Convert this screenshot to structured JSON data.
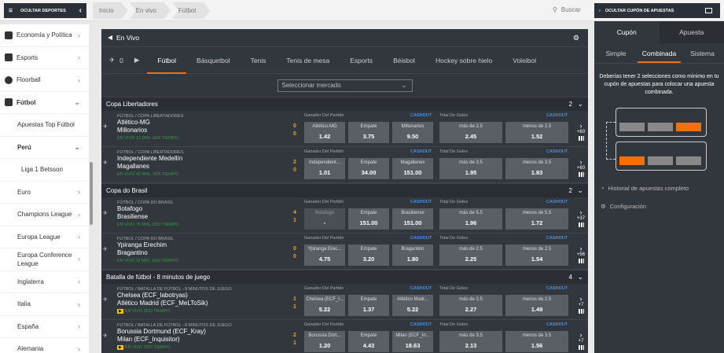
{
  "topbar": {
    "hide_sports": "OCULTAR DEPORTES",
    "breadcrumbs": [
      "Inicio",
      "En vivo",
      "Fútbol"
    ],
    "search_label": "Buscar",
    "hide_coupon": "OCULTAR CUPÓN DE APUESTAS"
  },
  "sidebar": {
    "items": [
      {
        "label": "Economía y Política"
      },
      {
        "label": "Esports"
      },
      {
        "label": "Floorball"
      },
      {
        "label": "Fútbol"
      },
      {
        "label": "Apuestas Top Fútbol"
      },
      {
        "label": "Perú"
      },
      {
        "label": "Liga 1 Betsson"
      },
      {
        "label": "Euro"
      },
      {
        "label": "Champions League"
      },
      {
        "label": "Europa League"
      },
      {
        "label": "Europa Conference League"
      },
      {
        "label": "Inglaterra"
      },
      {
        "label": "Italia"
      },
      {
        "label": "España"
      },
      {
        "label": "Alemania"
      }
    ]
  },
  "main": {
    "title": "En Vivo",
    "fav_count": "0",
    "tabs": [
      "Fútbol",
      "Básquetbol",
      "Tenis",
      "Tenis de mesa",
      "Esports",
      "Béisbol",
      "Hockey sobre hielo",
      "Voleibol"
    ],
    "market_placeholder": "Seleccionar mercado",
    "competitions": [
      {
        "name": "Copa Libertadores",
        "count": "2"
      },
      {
        "name": "Copa do Brasil",
        "count": "2"
      },
      {
        "name": "Batalla de fútbol - 8 minutos de juego",
        "count": "4"
      }
    ],
    "market1": "Ganador Del Partido",
    "market2": "Total De Goles",
    "cashout": "CASHOUT",
    "matches": [
      {
        "league": "FÚTBOL / COPA LIBERTADORES",
        "home": "Atlético-MG",
        "away": "Millonarios",
        "status": "EN VIVO 12 MIN, 1ER TIEMPO",
        "s1": "0",
        "s2": "0",
        "o1l": "Atlético-MG",
        "o1v": "1.42",
        "oxl": "Empate",
        "oxv": "3.75",
        "o2l": "Millonarios",
        "o2v": "9.50",
        "ul": "más de 2.5",
        "uv": "2.45",
        "dl": "menos de 2.5",
        "dv": "1.52",
        "more": "+60"
      },
      {
        "league": "FÚTBOL / COPA LIBERTADORES",
        "home": "Independiente Medellín",
        "away": "Magallanes",
        "status": "EN VIVO 42 MIN, 1ER TIEMPO",
        "s1": "2",
        "s2": "0",
        "o1l": "Independient...",
        "o1v": "1.01",
        "oxl": "Empate",
        "oxv": "34.00",
        "o2l": "Magallanes",
        "o2v": "151.00",
        "ul": "más de 3.5",
        "uv": "1.95",
        "dl": "menos de 3.5",
        "dv": "1.83",
        "more": "+60"
      },
      {
        "league": "FÚTBOL / COPA DO BRASIL",
        "home": "Botafogo",
        "away": "Brasiliense",
        "status": "EN VIVO 76 MIN, 2DO TIEMPO",
        "s1": "4",
        "s2": "1",
        "o1l": "Botafogo",
        "o1v": "-",
        "oxl": "Empate",
        "oxv": "151.00",
        "o2l": "Brasiliense",
        "o2v": "151.00",
        "ul": "más de 5.5",
        "uv": "1.96",
        "dl": "menos de 5.5",
        "dv": "1.72",
        "more": "+37"
      },
      {
        "league": "FÚTBOL / COPA DO BRASIL",
        "home": "Ypiranga Erechim",
        "away": "Bragantino",
        "status": "EN VIVO 11 MIN, 1ER TIEMPO",
        "s1": "0",
        "s2": "0",
        "o1l": "Ypiranga Erec...",
        "o1v": "4.75",
        "oxl": "Empate",
        "oxv": "3.20",
        "o2l": "Bragantino",
        "o2v": "1.80",
        "ul": "más de 2.5",
        "uv": "2.25",
        "dl": "menos de 2.5",
        "dv": "1.54",
        "more": "+56"
      },
      {
        "league": "FÚTBOL / BATALLA DE FÚTBOL - 8 MINUTOS DE JUEGO",
        "home": "Chelsea (ECF_labotryas)",
        "away": "Atlético Madrid (ECF_MeLToSik)",
        "status": "EN VIVO 2DO TIEMPO",
        "s1": "1",
        "s2": "1",
        "o1l": "Chelsea (ECF_l...",
        "o1v": "5.22",
        "oxl": "Empate",
        "oxv": "1.37",
        "o2l": "Atlético Madr...",
        "o2v": "5.22",
        "ul": "más de 2.5",
        "uv": "2.27",
        "dl": "menos de 2.5",
        "dv": "1.49",
        "more": "+7"
      },
      {
        "league": "FÚTBOL / BATALLA DE FÚTBOL - 8 MINUTOS DE JUEGO",
        "home": "Borussia Dortmund (ECF_Kray)",
        "away": "Milan (ECF_Inquisitor)",
        "status": "EN VIVO 2DO TIEMPO",
        "s1": "2",
        "s2": "1",
        "o1l": "Borussia Dort...",
        "o1v": "1.20",
        "oxl": "Empate",
        "oxv": "4.43",
        "o2l": "Milan (ECF_In...",
        "o2v": "18.63",
        "ul": "más de 3.5",
        "uv": "2.13",
        "dl": "menos de 3.5",
        "dv": "1.56",
        "more": "+7"
      }
    ]
  },
  "coupon": {
    "tabs": [
      "Cupón",
      "Apuesta"
    ],
    "subtabs": [
      "Simple",
      "Combinada",
      "Sistema"
    ],
    "message": "Deberías tener 2 selecciones como mínimo en tu cupón de apuestas para colocar una apuesta combinada.",
    "history": "Historial de apuestas completo",
    "settings": "Configuración"
  },
  "colors": {
    "accent": "#f2700a",
    "panel": "#32373e",
    "live": "#2e9e3a",
    "cashout": "#4a8fe0",
    "score": "#f2a20a"
  }
}
